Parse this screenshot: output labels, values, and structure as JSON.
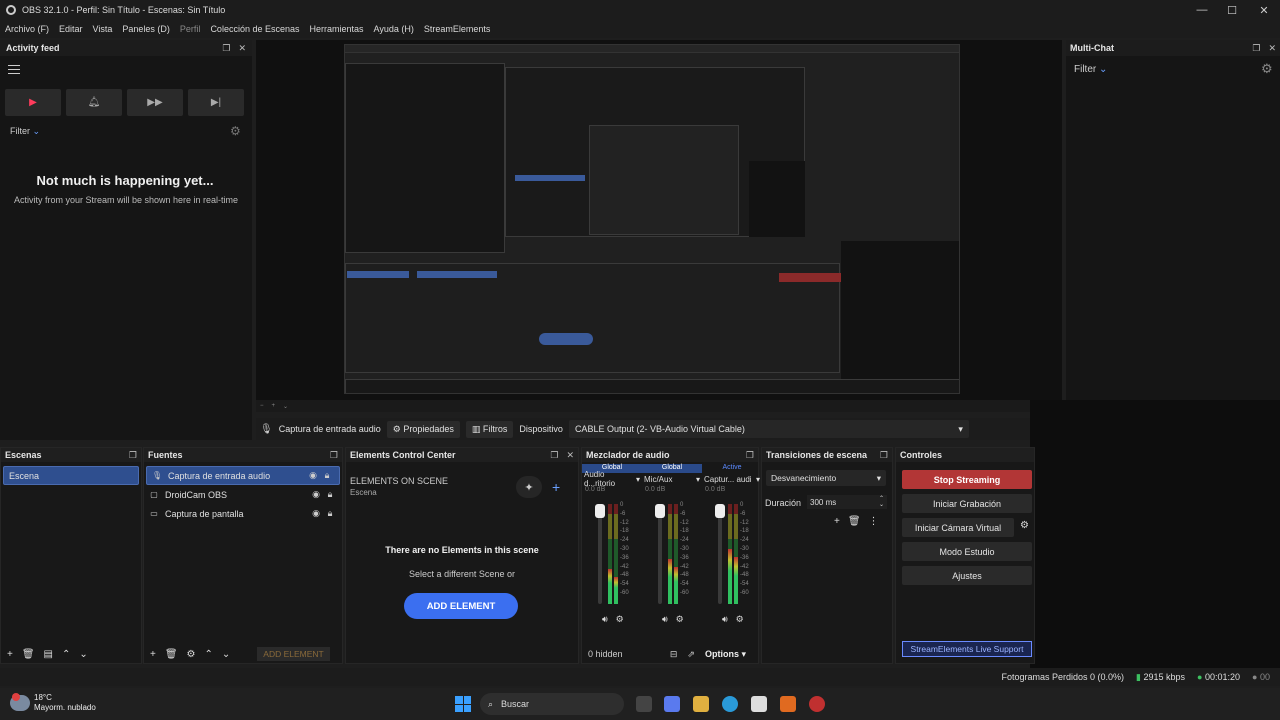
{
  "window": {
    "title": "OBS 32.1.0 - Perfil: Sin Título - Escenas: Sin Título"
  },
  "menu": [
    {
      "label": "Archivo (F)",
      "dim": false
    },
    {
      "label": "Editar",
      "dim": false
    },
    {
      "label": "Vista",
      "dim": false
    },
    {
      "label": "Paneles (D)",
      "dim": false
    },
    {
      "label": "Perfil",
      "dim": true
    },
    {
      "label": "Colección de Escenas",
      "dim": false
    },
    {
      "label": "Herramientas",
      "dim": false
    },
    {
      "label": "Ayuda (H)",
      "dim": false
    },
    {
      "label": "StreamElements",
      "dim": false
    }
  ],
  "activity_feed": {
    "title": "Activity feed",
    "filter_label": "Filter",
    "empty_title": "Not much is happening yet...",
    "empty_sub": "Activity from your Stream will be shown here in real-time"
  },
  "multichat": {
    "title": "Multi-Chat",
    "filter_label": "Filter"
  },
  "source_bar": {
    "source_name": "Captura de entrada audio",
    "properties_label": "Propiedades",
    "filters_label": "Filtros",
    "device_label": "Dispositivo",
    "device_value": "CABLE Output (2- VB-Audio Virtual Cable)"
  },
  "scenes": {
    "title": "Escenas",
    "items": [
      "Escena"
    ]
  },
  "sources": {
    "title": "Fuentes",
    "items": [
      "Captura de entrada audio",
      "DroidCam OBS",
      "Captura de pantalla"
    ],
    "add_element": "ADD ELEMENT"
  },
  "ecc": {
    "title": "Elements Control Center",
    "heading": "ELEMENTS ON SCENE",
    "scene": "Escena",
    "empty_title": "There are no Elements in this scene",
    "empty_sub": "Select a different Scene or",
    "add_button": "ADD ELEMENT"
  },
  "mixer": {
    "title": "Mezclador de audio",
    "channels": [
      {
        "tag": "Global",
        "name": "Audio d...ritorio",
        "db": "0.0 dB",
        "level": 0.35,
        "active": false
      },
      {
        "tag": "Global",
        "name": "Mic/Aux",
        "db": "0.0 dB",
        "level": 0.45,
        "active": false
      },
      {
        "tag": "Active",
        "name": "Captur... audi",
        "db": "0.0 dB",
        "level": 0.55,
        "active": true
      }
    ],
    "scale": [
      "0",
      "-6",
      "-12",
      "-18",
      "-24",
      "-30",
      "-36",
      "-42",
      "-48",
      "-54",
      "-60"
    ],
    "hidden": "0 hidden",
    "options": "Options"
  },
  "transitions": {
    "title": "Transiciones de escena",
    "selected": "Desvanecimiento",
    "duration_label": "Duración",
    "duration_value": "300 ms"
  },
  "controls": {
    "title": "Controles",
    "stop_streaming": "Stop Streaming",
    "start_recording": "Iniciar Grabación",
    "virtual_cam": "Iniciar Cámara Virtual",
    "studio_mode": "Modo Estudio",
    "settings": "Ajustes",
    "support": "StreamElements Live Support"
  },
  "status": {
    "dropped_frames": "Fotogramas Perdidos 0 (0.0%)",
    "bitrate": "2915 kbps",
    "time": "00:01:20",
    "cpu": "00"
  },
  "taskbar": {
    "temp": "18°C",
    "weather": "Mayorm. nublado",
    "search": "Buscar"
  },
  "colors": {
    "accent": "#3b6ff0",
    "stop": "#b23636",
    "selection": "#2f4f8f"
  }
}
